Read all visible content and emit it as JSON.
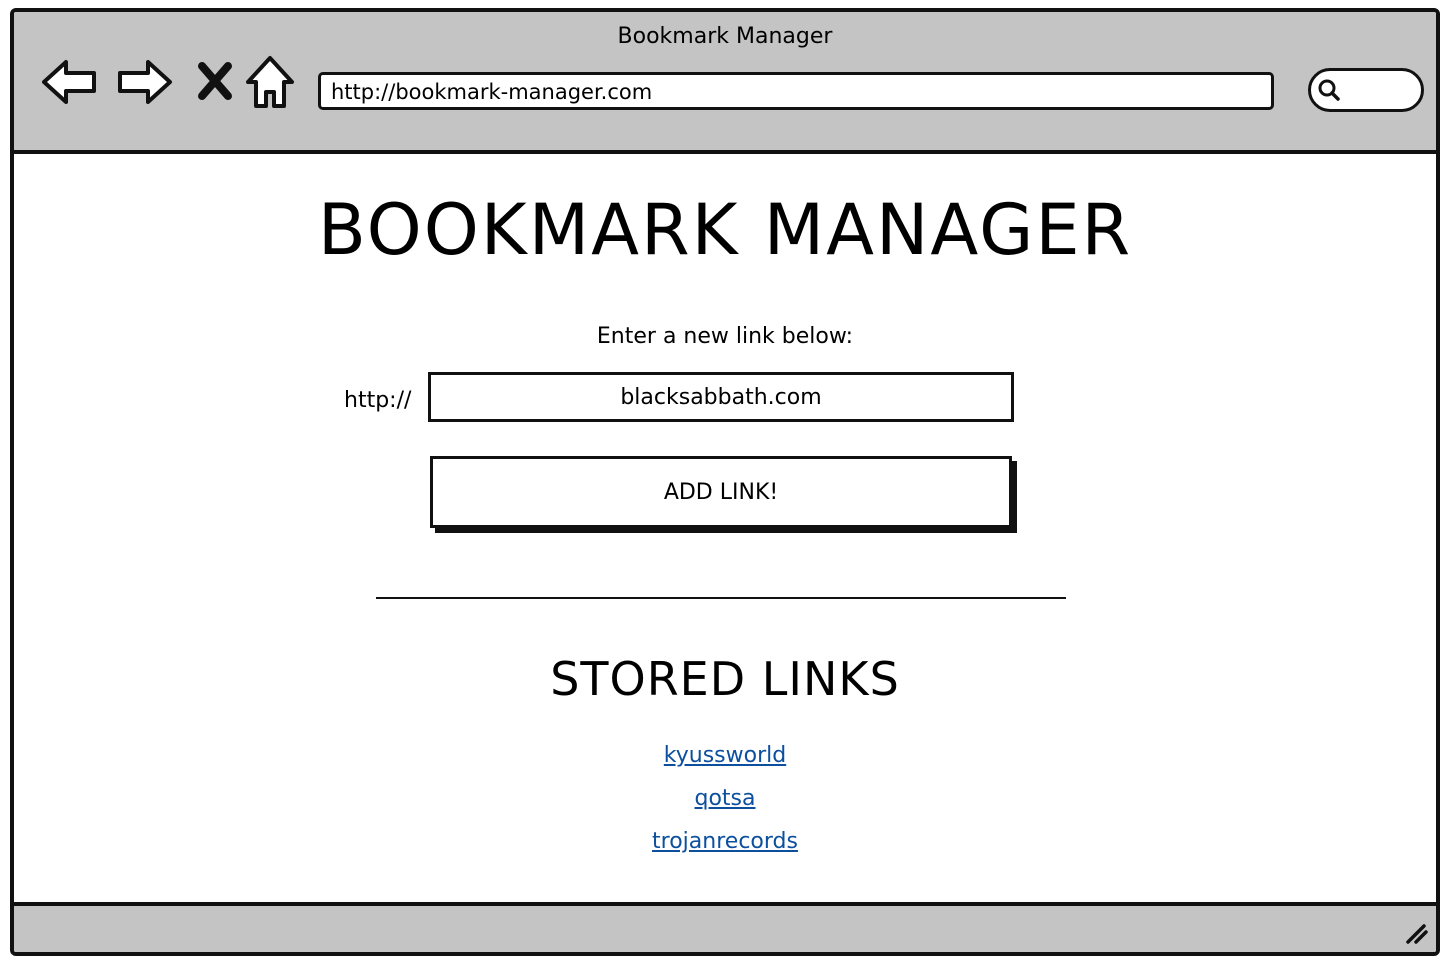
{
  "window": {
    "title": "Bookmark Manager"
  },
  "toolbar": {
    "back_icon": "back-arrow-icon",
    "forward_icon": "forward-arrow-icon",
    "stop_icon": "close-icon",
    "home_icon": "home-icon",
    "url": "http://bookmark-manager.com",
    "search_icon": "search-icon",
    "search_value": ""
  },
  "main": {
    "heading": "BOOKMARK MANAGER",
    "prompt": "Enter a new link below:",
    "prefix": "http://",
    "link_input_value": "blacksabbath.com",
    "add_button_label": "ADD LINK!",
    "stored_heading": "STORED LINKS",
    "links": [
      {
        "label": "kyussworld"
      },
      {
        "label": "qotsa"
      },
      {
        "label": "trojanrecords"
      }
    ]
  },
  "colors": {
    "chrome": "#c4c4c4",
    "link": "#0b4f9e",
    "border": "#111111"
  }
}
